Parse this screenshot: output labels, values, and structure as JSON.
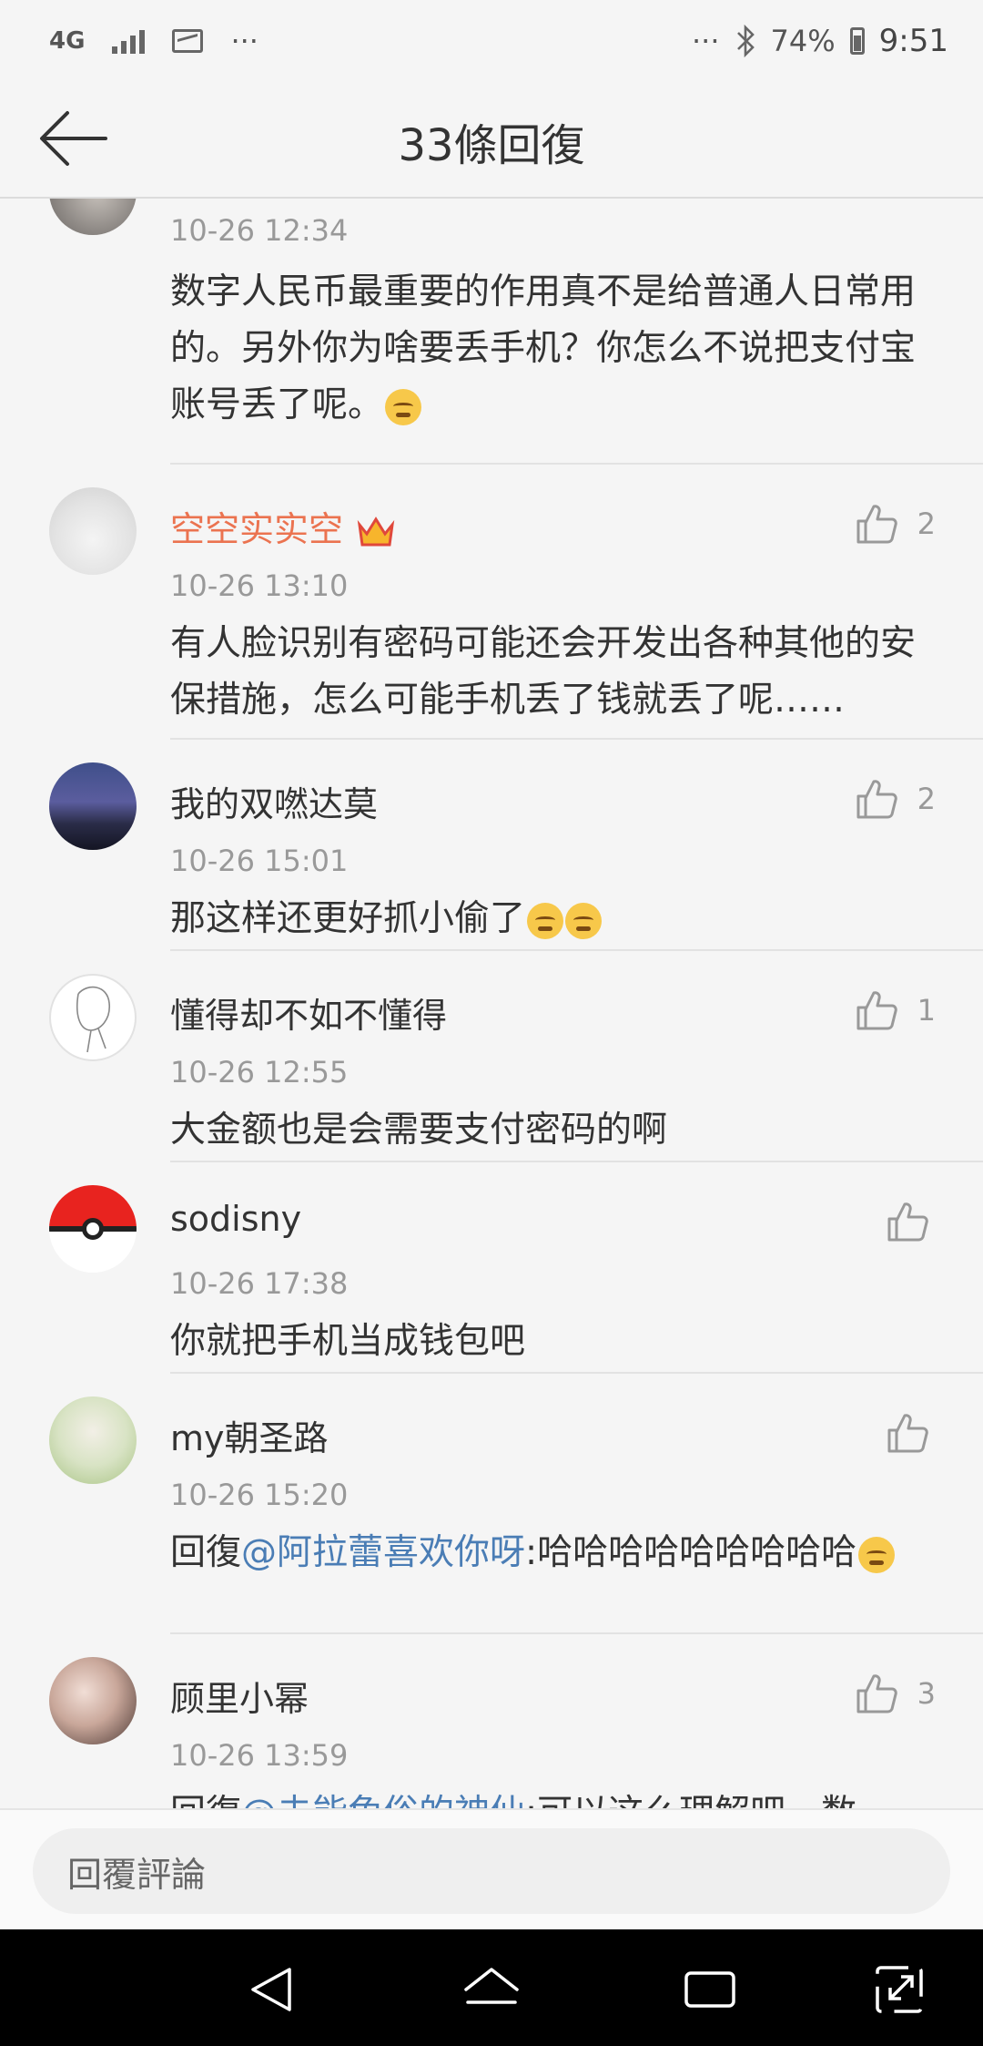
{
  "status_bar": {
    "network": "4G",
    "more": "···",
    "battery": "74%",
    "time": "9:51"
  },
  "header": {
    "title": "33條回復"
  },
  "comments": [
    {
      "time": "10-26 12:34",
      "text": "数字人民币最重要的作用真不是给普通人日常用的。另外你为啥要丢手机？你怎么不说把支付宝账号丢了呢。"
    },
    {
      "name": "空空实实空",
      "time": "10-26 13:10",
      "likes": "2",
      "text": "有人脸识别有密码可能还会开发出各种其他的安保措施，怎么可能手机丢了钱就丢了呢……"
    },
    {
      "name": "我的双嘫达莫",
      "time": "10-26 15:01",
      "likes": "2",
      "text": "那这样还更好抓小偷了"
    },
    {
      "name": "懂得却不如不懂得",
      "time": "10-26 12:55",
      "likes": "1",
      "text": "大金额也是会需要支付密码的啊"
    },
    {
      "name": "sodisny",
      "time": "10-26 17:38",
      "text": "你就把手机当成钱包吧"
    },
    {
      "name": "my朝圣路",
      "time": "10-26 15:20",
      "reply_prefix": "回復",
      "mention": "@阿拉蕾喜欢你呀",
      "text": ":哈哈哈哈哈哈哈哈哈"
    },
    {
      "name": "顾里小幂",
      "time": "10-26 13:59",
      "likes": "3",
      "reply_prefix": "回復",
      "mention": "@未能免俗的神仙",
      "text": ":可以这么理解吧，数"
    }
  ],
  "reply_bar": {
    "placeholder": "回覆評論"
  },
  "colors": {
    "vip_name": "#eb7350",
    "mention": "#4a7db5",
    "meta": "#999999"
  }
}
